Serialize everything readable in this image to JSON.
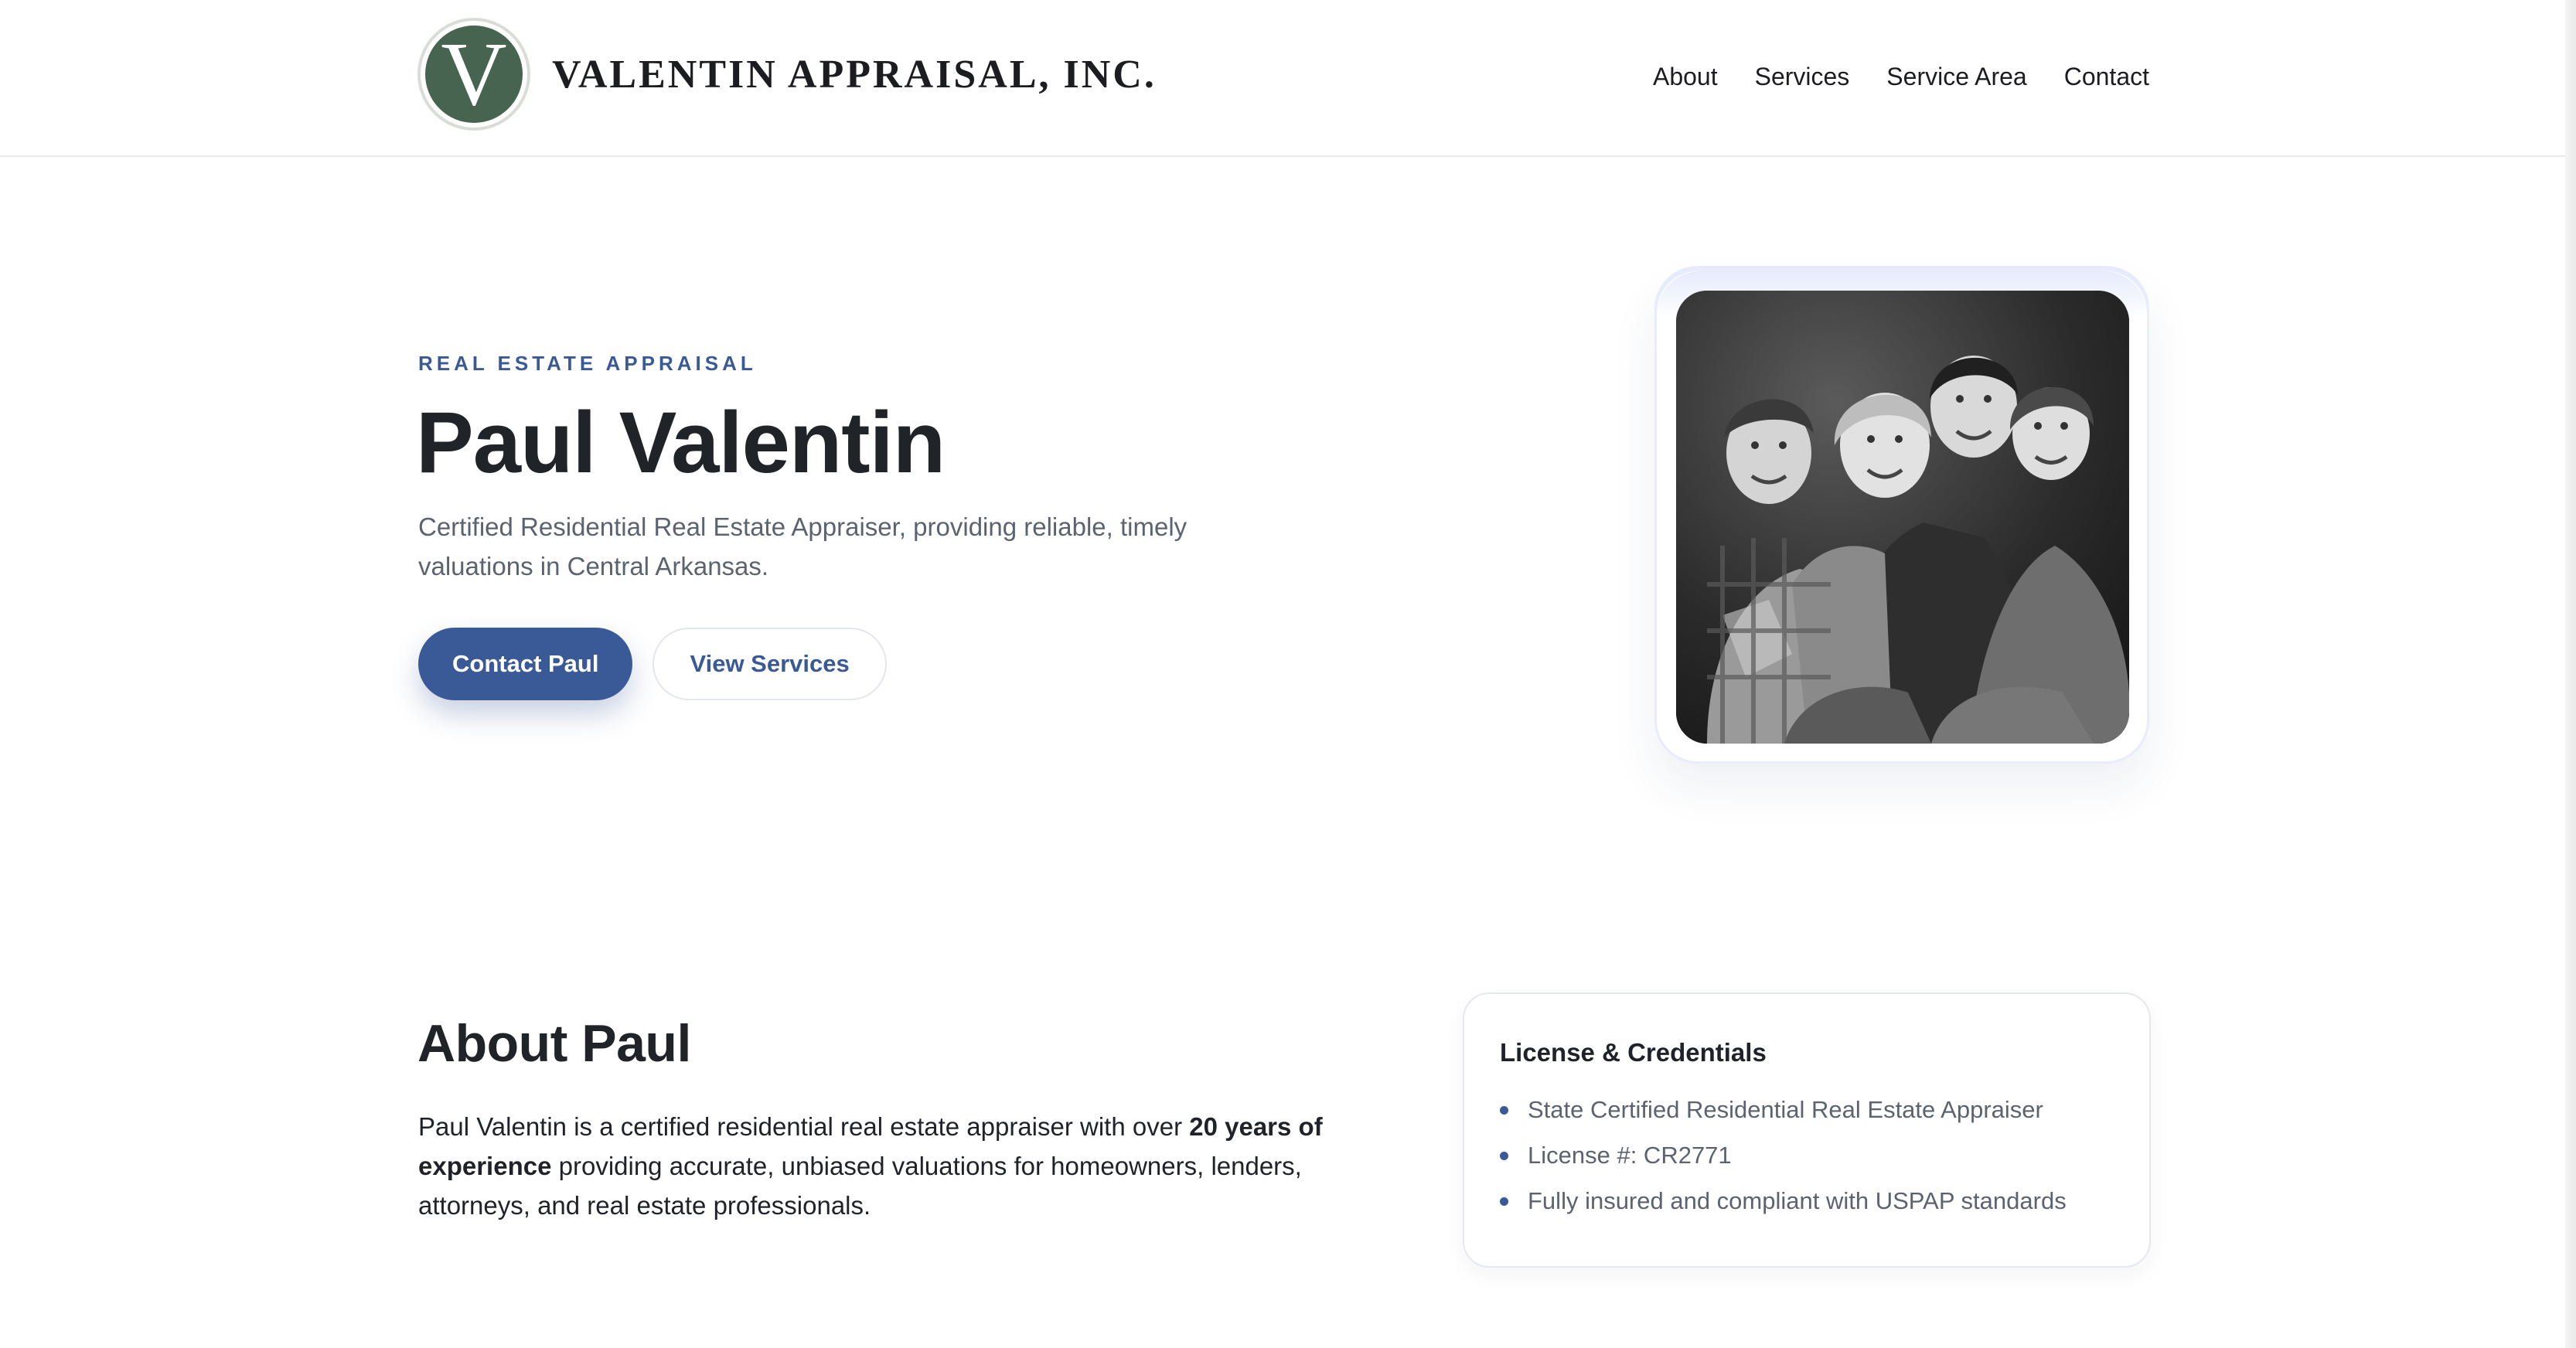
{
  "header": {
    "logo_letter": "V",
    "brand_name": "VALENTIN APPRAISAL, INC.",
    "nav": [
      {
        "label": "About"
      },
      {
        "label": "Services"
      },
      {
        "label": "Service Area"
      },
      {
        "label": "Contact"
      }
    ]
  },
  "hero": {
    "eyebrow": "REAL ESTATE APPRAISAL",
    "title": "Paul Valentin",
    "subtitle": "Certified Residential Real Estate Appraiser, providing reliable, timely valuations in Central Arkansas.",
    "primary_button": "Contact Paul",
    "secondary_button": "View Services"
  },
  "about": {
    "title": "About Paul",
    "body_before": "Paul Valentin is a certified residential real estate appraiser with over ",
    "body_bold": "20 years of experience",
    "body_after": " providing accurate, unbiased valuations for homeowners, lenders, attorneys, and real estate professionals."
  },
  "credentials": {
    "title": "License & Credentials",
    "items": [
      "State Certified Residential Real Estate Appraiser",
      "License #: CR2771",
      "Fully insured and compliant with USPAP standards"
    ]
  },
  "colors": {
    "accent": "#3a5a97",
    "logo_green": "#46644f",
    "text_dark": "#202328",
    "text_muted": "#5c6370"
  }
}
